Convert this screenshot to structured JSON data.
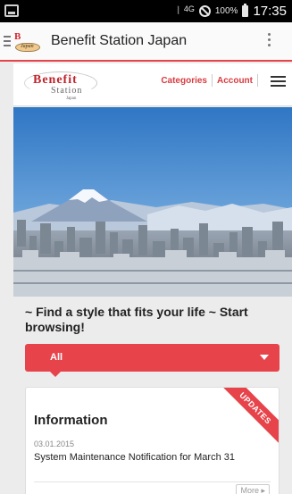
{
  "status_bar": {
    "network": "4G",
    "battery_percent": "100%",
    "time": "17:35"
  },
  "app_bar": {
    "title": "Benefit Station Japan",
    "logo_letter": "B",
    "logo_text": "Japan"
  },
  "site_header": {
    "logo": {
      "word": "Benefit",
      "sub": "Station",
      "small": "Japan"
    },
    "nav": [
      "Categories",
      "Account"
    ]
  },
  "tagline": "~ Find a style that fits your life ~ Start browsing!",
  "dropdown": {
    "selected": "All"
  },
  "info_card": {
    "ribbon": "UPDATES",
    "heading": "Information",
    "date": "03.01.2015",
    "item": "System Maintenance Notification for March 31",
    "more": "More ▸"
  },
  "colors": {
    "accent": "#e7434a",
    "status_bar": "#000000",
    "background": "#ececec"
  }
}
